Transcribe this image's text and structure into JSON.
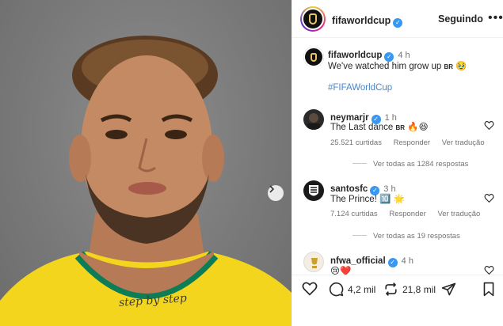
{
  "post_header": {
    "username": "fifaworldcup",
    "follow_label": "Seguindo",
    "more_label": "•••"
  },
  "caption": {
    "username": "fifaworldcup",
    "time": "4 h",
    "text": "We've watched him grow up",
    "flag_code": "BR",
    "emoji": "🥹",
    "hashtag": "#FIFAWorldCup"
  },
  "comments": [
    {
      "username": "neymarjr",
      "time": "1 h",
      "text": "The Last dance",
      "flag_code": "BR",
      "emojis": "🔥😆",
      "likes": "25.521 curtidas",
      "reply_label": "Responder",
      "translate_label": "Ver tradução",
      "view_replies": "Ver todas as 1284 respostas"
    },
    {
      "username": "santosfc",
      "time": "3 h",
      "text": "The Prince!",
      "emojis": "🔟 🌟",
      "likes": "7.124 curtidas",
      "reply_label": "Responder",
      "translate_label": "Ver tradução",
      "view_replies": "Ver todas as 19 respostas"
    },
    {
      "username": "nfwa_official",
      "time": "4 h",
      "text": "😢❤️"
    }
  ],
  "actions": {
    "comments_count": "4,2 mil",
    "shares_count": "21,8 mil"
  },
  "media": {
    "tattoo_text": "step by step"
  },
  "colors": {
    "link": "#4a86c8",
    "verified": "#3897f0",
    "muted": "#737373",
    "jersey_yellow": "#f4d51e",
    "jersey_green": "#0d7d55"
  }
}
